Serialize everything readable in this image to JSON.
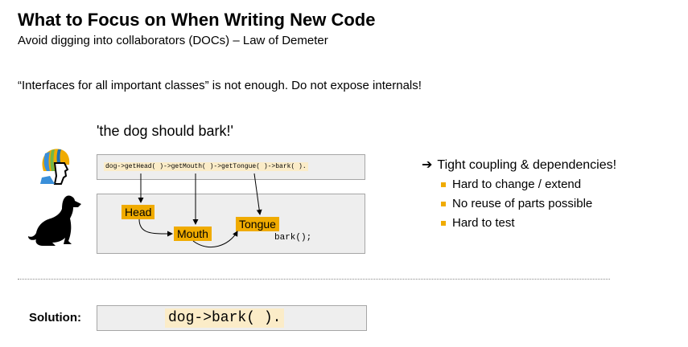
{
  "slide": {
    "title": "What to Focus on When Writing New Code",
    "subtitle": "Avoid digging into collaborators (DOCs) – Law of Demeter",
    "statement": "“Interfaces for all important classes” is not enough. Do not expose internals!",
    "quote": "'the dog should bark!'",
    "code_chain": "dog->getHead( )->getMouth( )->getTongue( )->bark( ).",
    "diagram": {
      "nodes": {
        "head": "Head",
        "mouth": "Mouth",
        "tongue": "Tongue"
      },
      "call": "bark();"
    },
    "consequence": {
      "arrow": "➔",
      "text": "Tight coupling & dependencies!",
      "bullets": [
        "Hard to change / extend",
        "No reuse of parts possible",
        "Hard to test"
      ]
    },
    "solution": {
      "label": "Solution:",
      "code": "dog->bark( )."
    },
    "icons": {
      "developer": "developer-head-icon",
      "dog": "dog-silhouette-icon"
    },
    "colors": {
      "accent": "#f0ab00",
      "highlight": "#fbecc8",
      "box_bg": "#eeeeee",
      "box_border": "#a6a6a6"
    }
  }
}
